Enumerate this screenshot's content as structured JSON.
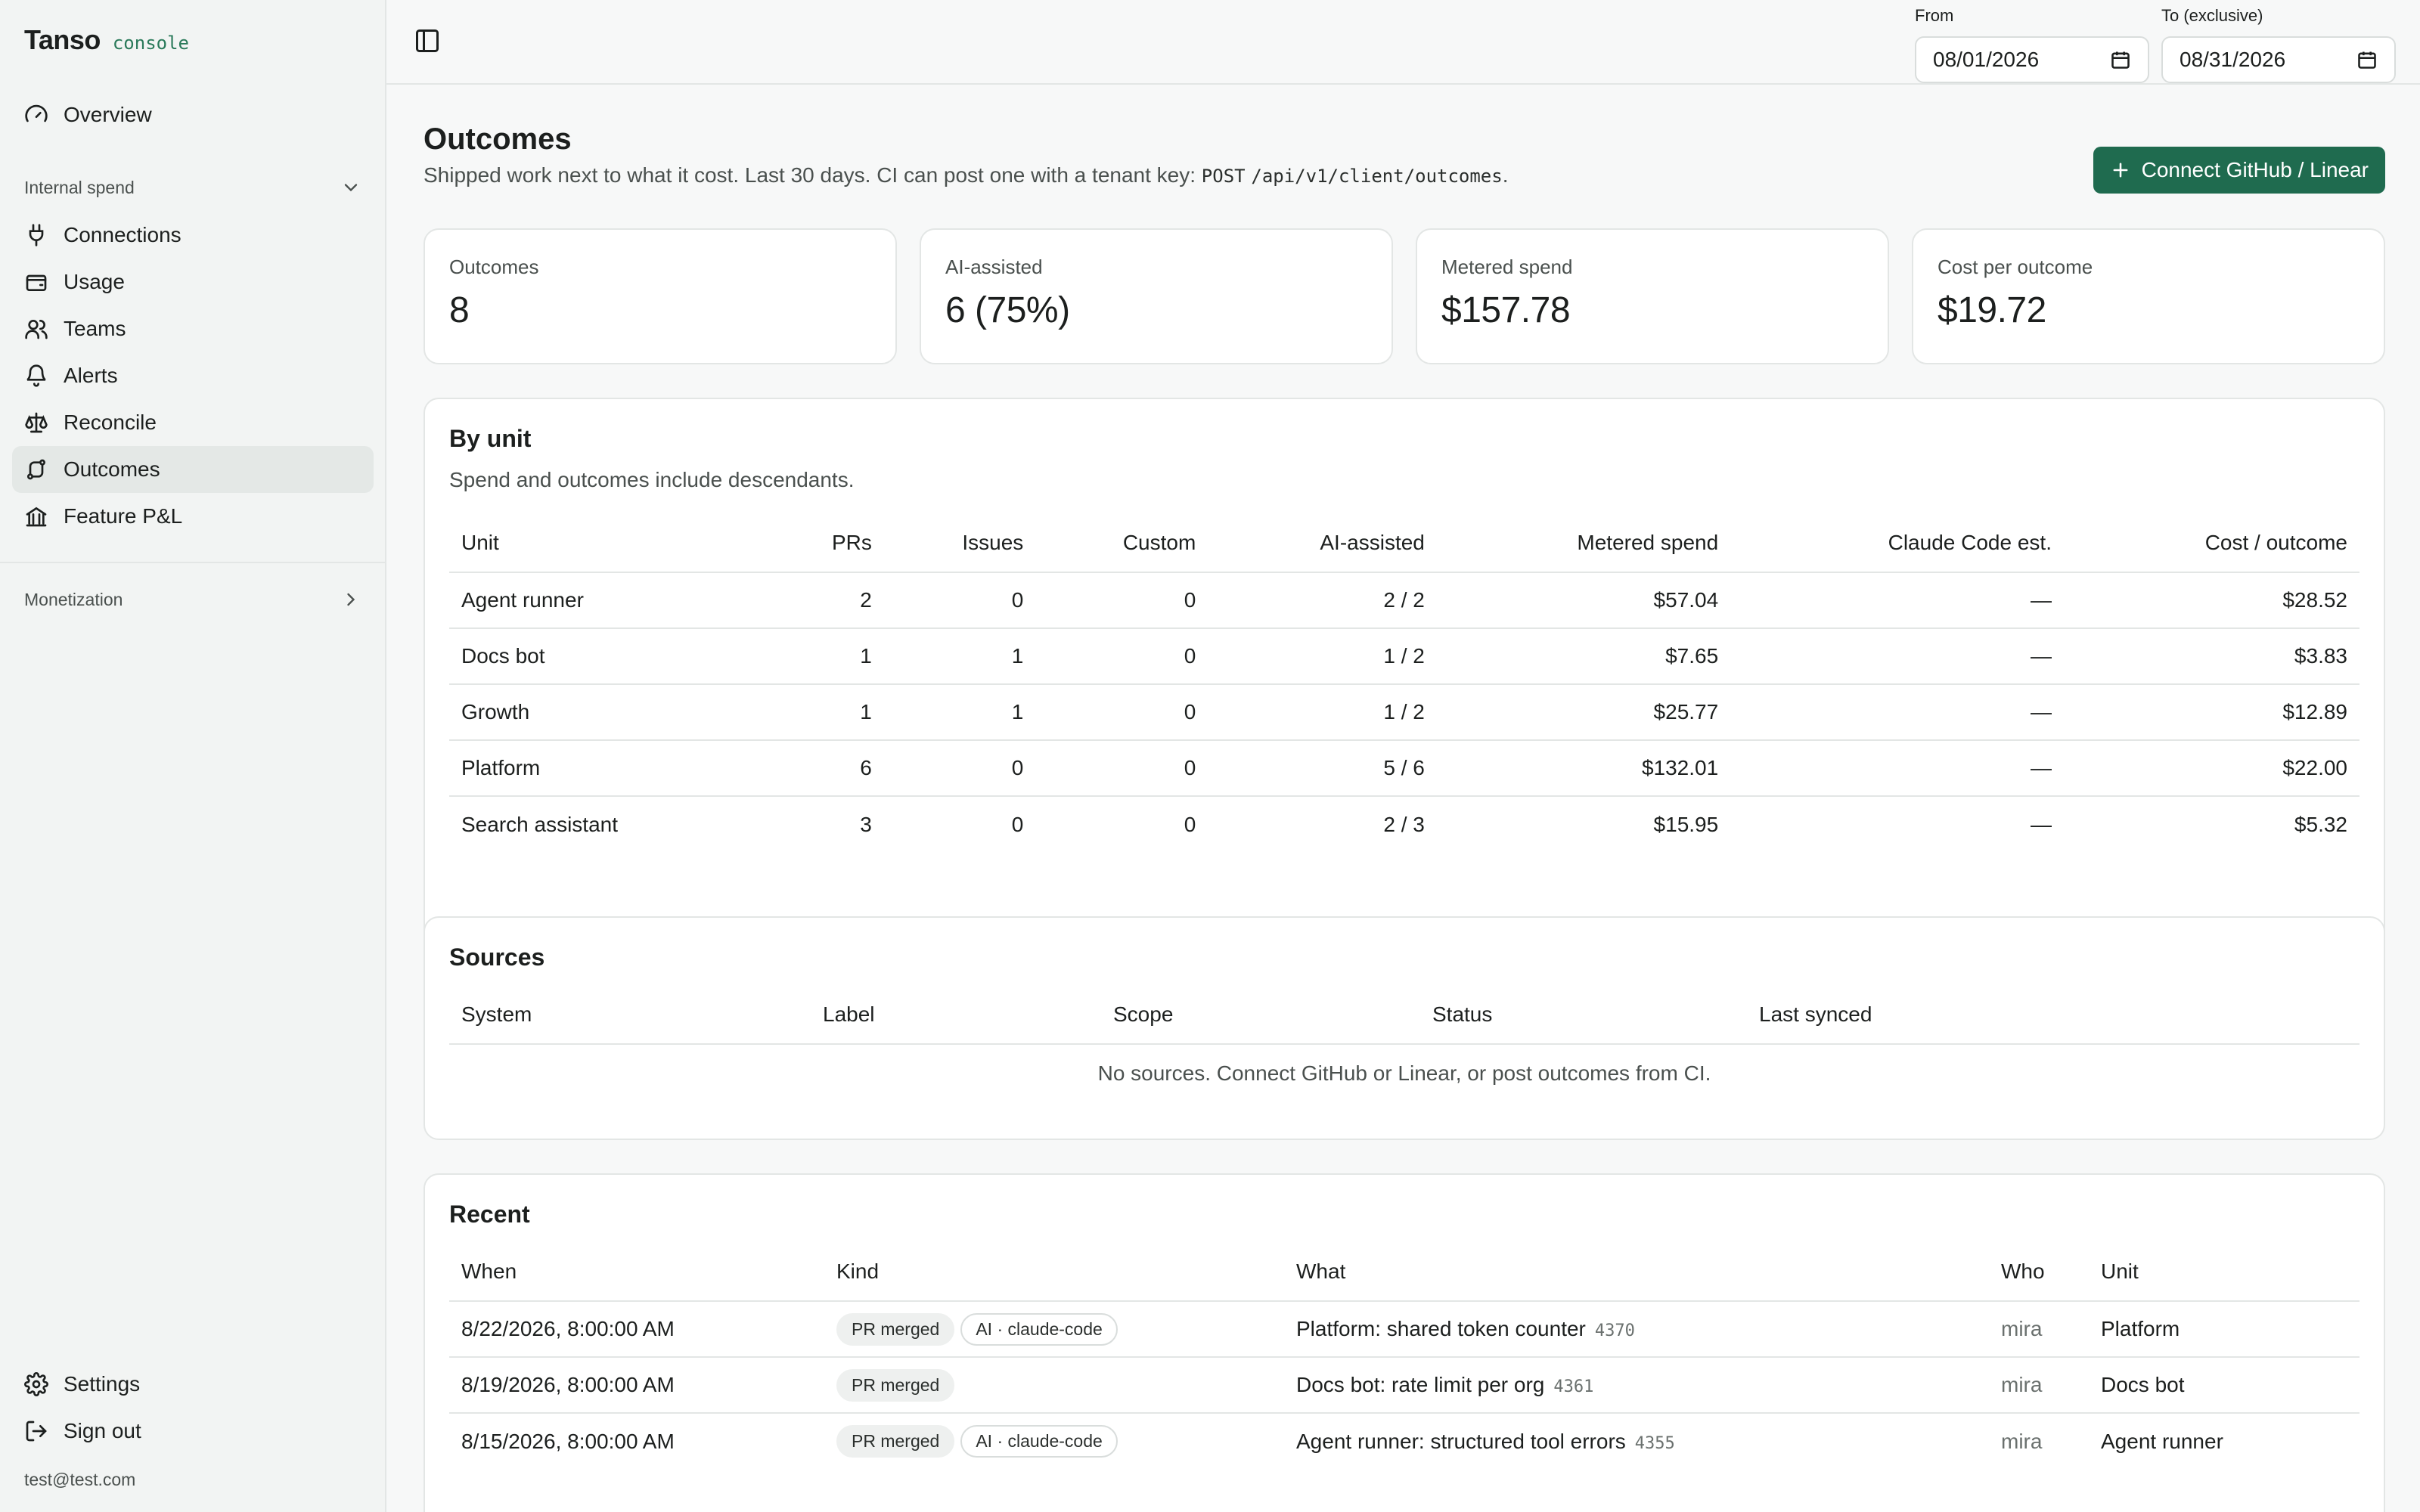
{
  "brand": {
    "name": "Tanso",
    "tag": "console"
  },
  "sidebar": {
    "overview": "Overview",
    "internal_spend": "Internal spend",
    "items": [
      {
        "label": "Connections",
        "icon": "plug-icon"
      },
      {
        "label": "Usage",
        "icon": "wallet-icon"
      },
      {
        "label": "Teams",
        "icon": "users-icon"
      },
      {
        "label": "Alerts",
        "icon": "bell-icon"
      },
      {
        "label": "Reconcile",
        "icon": "scale-icon"
      },
      {
        "label": "Outcomes",
        "icon": "route-icon",
        "active": true
      },
      {
        "label": "Feature P&L",
        "icon": "bank-icon"
      }
    ],
    "monetization": "Monetization",
    "settings": "Settings",
    "sign_out": "Sign out",
    "user_email": "test@test.com"
  },
  "topbar": {
    "from_label": "From",
    "from_value": "08/01/2026",
    "to_label": "To (exclusive)",
    "to_value": "08/31/2026"
  },
  "page": {
    "title": "Outcomes",
    "subtitle": "Shipped work next to what it cost. Last 30 days. CI can post one with a tenant key:",
    "endpoint_method": "POST",
    "endpoint_path": "/api/v1/client/outcomes",
    "subtitle_end": ".",
    "connect_button": "Connect GitHub / Linear"
  },
  "stats": [
    {
      "label": "Outcomes",
      "value": "8"
    },
    {
      "label": "AI-assisted",
      "value": "6 (75%)"
    },
    {
      "label": "Metered spend",
      "value": "$157.78"
    },
    {
      "label": "Cost per outcome",
      "value": "$19.72"
    }
  ],
  "by_unit": {
    "title": "By unit",
    "subtitle": "Spend and outcomes include descendants.",
    "columns": [
      "Unit",
      "PRs",
      "Issues",
      "Custom",
      "AI-assisted",
      "Metered spend",
      "Claude Code est.",
      "Cost / outcome"
    ],
    "rows": [
      [
        "Agent runner",
        "2",
        "0",
        "0",
        "2 / 2",
        "$57.04",
        "—",
        "$28.52"
      ],
      [
        "Docs bot",
        "1",
        "1",
        "0",
        "1 / 2",
        "$7.65",
        "—",
        "$3.83"
      ],
      [
        "Growth",
        "1",
        "1",
        "0",
        "1 / 2",
        "$25.77",
        "—",
        "$12.89"
      ],
      [
        "Platform",
        "6",
        "0",
        "0",
        "5 / 6",
        "$132.01",
        "—",
        "$22.00"
      ],
      [
        "Search assistant",
        "3",
        "0",
        "0",
        "2 / 3",
        "$15.95",
        "—",
        "$5.32"
      ]
    ]
  },
  "sources": {
    "title": "Sources",
    "columns": [
      "System",
      "Label",
      "Scope",
      "Status",
      "Last synced"
    ],
    "empty": "No sources. Connect GitHub or Linear, or post outcomes from CI."
  },
  "recent": {
    "title": "Recent",
    "columns": [
      "When",
      "Kind",
      "What",
      "Who",
      "Unit"
    ],
    "rows": [
      {
        "when": "8/22/2026, 8:00:00 AM",
        "kind": "PR merged",
        "ai": "AI · claude-code",
        "what": "Platform: shared token counter",
        "ref": "4370",
        "who": "mira",
        "unit": "Platform"
      },
      {
        "when": "8/19/2026, 8:00:00 AM",
        "kind": "PR merged",
        "ai": "",
        "what": "Docs bot: rate limit per org",
        "ref": "4361",
        "who": "mira",
        "unit": "Docs bot"
      },
      {
        "when": "8/15/2026, 8:00:00 AM",
        "kind": "PR merged",
        "ai": "AI · claude-code",
        "what": "Agent runner: structured tool errors",
        "ref": "4355",
        "who": "mira",
        "unit": "Agent runner"
      }
    ]
  }
}
